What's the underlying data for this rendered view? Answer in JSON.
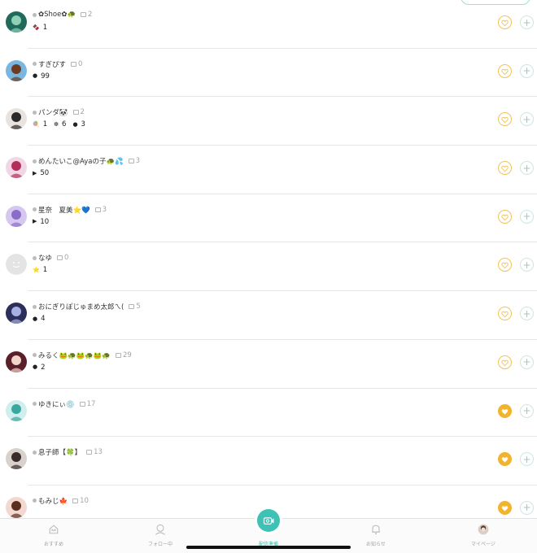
{
  "colors": {
    "accent": "#3fc2b6",
    "heart": "#f2b42c",
    "divider": "#e6e6e6"
  },
  "rows": [
    {
      "name": "✿Shoe✿🐢",
      "comments": "2",
      "heart_filled": false,
      "avatar": {
        "bg": "#1f6a5a",
        "fg": "#8fd1b5"
      },
      "stats": [
        {
          "icon": "🍫",
          "value": "1"
        }
      ]
    },
    {
      "name": "すぎぴす",
      "comments": "0",
      "heart_filled": false,
      "avatar": {
        "bg": "#7ab7e0",
        "fg": "#6b3b22"
      },
      "stats": [
        {
          "icon": "●",
          "value": "99"
        }
      ]
    },
    {
      "name": "パンダ🐼",
      "comments": "2",
      "heart_filled": false,
      "avatar": {
        "bg": "#e8e3df",
        "fg": "#2a2a2a"
      },
      "stats": [
        {
          "icon": "🍭",
          "value": "1"
        },
        {
          "icon": "❇",
          "value": "6"
        },
        {
          "icon": "●",
          "value": "3"
        }
      ]
    },
    {
      "name": "めんたいこ@Ayaの子🐢💦",
      "comments": "3",
      "heart_filled": false,
      "avatar": {
        "bg": "#f1d7e6",
        "fg": "#b42e59"
      },
      "stats": [
        {
          "icon": "▶",
          "value": "50"
        }
      ]
    },
    {
      "name": "星奈　夏美⭐💙",
      "comments": "3",
      "heart_filled": false,
      "avatar": {
        "bg": "#d6c7f0",
        "fg": "#8b6cc9"
      },
      "stats": [
        {
          "icon": "▶",
          "value": "10"
        }
      ]
    },
    {
      "name": "なゆ",
      "comments": "0",
      "heart_filled": false,
      "avatar": {
        "bg": "#e4e4e4",
        "fg": "#ffffff"
      },
      "stats": [
        {
          "icon": "⭐",
          "value": "1"
        }
      ]
    },
    {
      "name": "おにぎりぽじゅまめ太郎ㄟ(",
      "comments": "5",
      "heart_filled": false,
      "avatar": {
        "bg": "#2d2f5a",
        "fg": "#a7b0e6"
      },
      "stats": [
        {
          "icon": "●",
          "value": "4"
        }
      ]
    },
    {
      "name": "みるく🐸🐢🐸🐢🐸🐢",
      "comments": "29",
      "heart_filled": false,
      "avatar": {
        "bg": "#5a1f2a",
        "fg": "#f2d5c9"
      },
      "stats": [
        {
          "icon": "●",
          "value": "2"
        }
      ]
    },
    {
      "name": "ゆきにぃ💿",
      "comments": "17",
      "heart_filled": true,
      "avatar": {
        "bg": "#cfeeed",
        "fg": "#3aa7a0"
      },
      "stats": []
    },
    {
      "name": "息子師【🍀】",
      "comments": "13",
      "heart_filled": true,
      "avatar": {
        "bg": "#d9d2cc",
        "fg": "#3a2a2a"
      },
      "stats": []
    },
    {
      "name": "もみじ🍁",
      "comments": "10",
      "heart_filled": true,
      "avatar": {
        "bg": "#f3d8cf",
        "fg": "#5a2f22"
      },
      "stats": []
    }
  ],
  "tabbar": {
    "tabs": [
      {
        "label": "おすすめ"
      },
      {
        "label": "フォロー中"
      },
      {
        "label": "配信準備"
      },
      {
        "label": "お知らせ"
      },
      {
        "label": "マイページ"
      }
    ]
  }
}
